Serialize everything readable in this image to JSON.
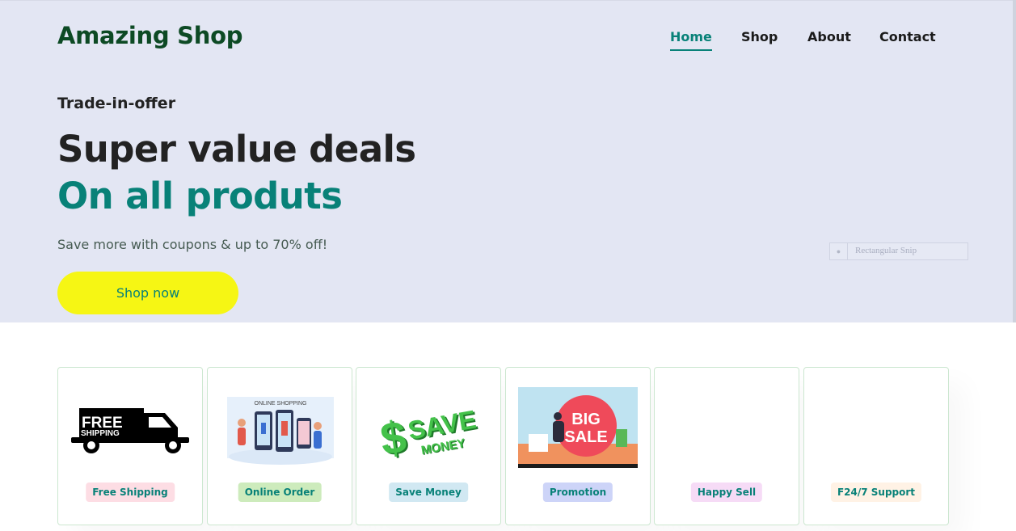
{
  "header": {
    "logo": "Amazing Shop",
    "nav": [
      {
        "label": "Home",
        "active": true
      },
      {
        "label": "Shop",
        "active": false
      },
      {
        "label": "About",
        "active": false
      },
      {
        "label": "Contact",
        "active": false
      }
    ]
  },
  "hero": {
    "kicker": "Trade-in-offer",
    "title": "Super value deals",
    "title_accent": "On all produts",
    "text": "Save more with coupons & up to 70% off!",
    "button": "Shop now",
    "snip_label": "Rectangular Snip"
  },
  "features": [
    {
      "label": "Free Shipping",
      "tag_color": "#fddde4",
      "image_text": "FREE SHIPPING"
    },
    {
      "label": "Online Order",
      "tag_color": "#cdebbc",
      "image_text": "ONLINE SHOPPING"
    },
    {
      "label": "Save Money",
      "tag_color": "#d1e8f2",
      "image_text": "SAVE MONEY"
    },
    {
      "label": "Promotion",
      "tag_color": "#cdd4f8",
      "image_text": "BIG SALE"
    },
    {
      "label": "Happy Sell",
      "tag_color": "#f6dbf6",
      "image_text": ""
    },
    {
      "label": "F24/7 Support",
      "tag_color": "#fff2e5",
      "image_text": ""
    }
  ],
  "colors": {
    "brand": "#088178",
    "logo": "#0d4a24",
    "hero_bg": "#e3e6f3",
    "button": "#f6f614"
  }
}
